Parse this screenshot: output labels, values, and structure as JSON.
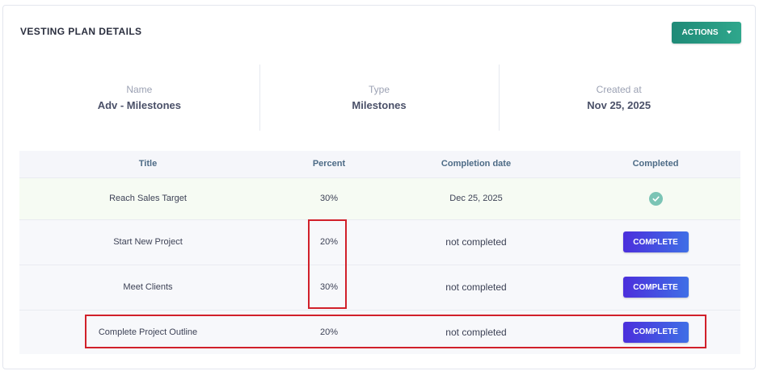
{
  "card": {
    "title": "VESTING PLAN DETAILS"
  },
  "actions": {
    "label": "ACTIONS",
    "icon": "caret-down-icon",
    "color": "#2a9a82"
  },
  "info": [
    {
      "label": "Name",
      "value": "Adv - Milestones"
    },
    {
      "label": "Type",
      "value": "Milestones"
    },
    {
      "label": "Created at",
      "value": "Nov 25, 2025"
    }
  ],
  "table": {
    "headers": [
      "Title",
      "Percent",
      "Completion date",
      "Completed"
    ],
    "rows": [
      {
        "title": "Reach Sales Target",
        "percent": "30%",
        "date": "Dec 25, 2025",
        "completed_icon": "check-circle-icon"
      },
      {
        "title": "Start New Project",
        "percent": "20%",
        "date": "not completed",
        "button": "COMPLETE"
      },
      {
        "title": "Meet Clients",
        "percent": "30%",
        "date": "not completed",
        "button": "COMPLETE"
      },
      {
        "title": "Complete Project Outline",
        "percent": "20%",
        "date": "not completed",
        "button": "COMPLETE"
      }
    ]
  },
  "colors": {
    "highlight": "#d1202a",
    "complete_button": "#4b3fe0",
    "check": "#7bc4b5"
  }
}
